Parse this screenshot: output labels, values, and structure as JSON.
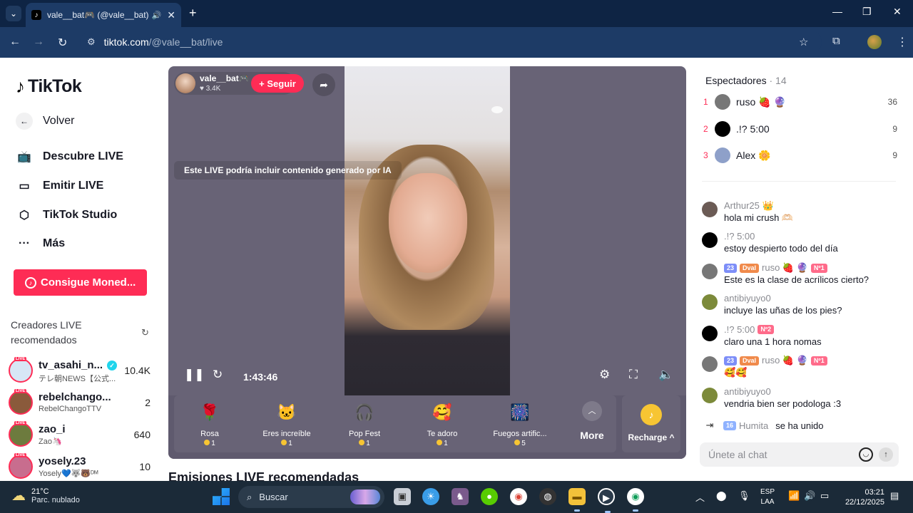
{
  "browser": {
    "tab_title": "vale__bat🎮 (@vale__bat) e",
    "url_host": "tiktok.com",
    "url_path": "/@vale__bat/live"
  },
  "sidebar": {
    "logo": "TikTok",
    "back_label": "Volver",
    "nav": [
      {
        "label": "Descubre LIVE",
        "icon": "tv-icon"
      },
      {
        "label": "Emitir LIVE",
        "icon": "camera-icon"
      },
      {
        "label": "TikTok Studio",
        "icon": "studio-icon"
      },
      {
        "label": "Más",
        "icon": "more-icon"
      }
    ],
    "coins_button": "Consigue Moned...",
    "recommended_title": "Creadores LIVE recomendados",
    "creators": [
      {
        "name": "tv_asahi_n...",
        "sub": "テレ朝NEWS【公式...",
        "count": "10.4K",
        "verified": true,
        "color": "#d7e6f5"
      },
      {
        "name": "rebelchango...",
        "sub": "RebelChangoTTV",
        "count": "2",
        "color": "#8a5a3b"
      },
      {
        "name": "zao_i",
        "sub": "Zao🦄",
        "count": "640",
        "color": "#6d7b3e"
      },
      {
        "name": "yosely.23",
        "sub": "Yosely💙🐺🐻ᴰᴹ",
        "count": "10",
        "color": "#c86d8e"
      }
    ],
    "live_tag": "LIVE"
  },
  "player": {
    "host_name": "vale__bat🎮",
    "host_likes": "♥ 3.4K",
    "follow": "+ Seguir",
    "ai_notice": "Este LIVE podría incluir contenido generado por IA",
    "elapsed": "1:43:46",
    "gifts": [
      {
        "name": "Rosa",
        "price": "1",
        "icon": "🌹"
      },
      {
        "name": "Eres increíble",
        "price": "1",
        "icon": "🐱"
      },
      {
        "name": "Pop Fest",
        "price": "1",
        "icon": "🎧"
      },
      {
        "name": "Te adoro",
        "price": "1",
        "icon": "🥰"
      },
      {
        "name": "Fuegos artific...",
        "price": "5",
        "icon": "🎆"
      }
    ],
    "more_label": "More",
    "recharge_label": "Recharge ^"
  },
  "below_section": "Emisiones LIVE recomendadas",
  "viewers": {
    "title": "Espectadores",
    "count": "· 14",
    "top": [
      {
        "rank": "1",
        "name": "ruso 🍓 🔮",
        "score": "36",
        "color": "#777"
      },
      {
        "rank": "2",
        "name": ".!? 5:00",
        "score": "9",
        "color": "#000"
      },
      {
        "rank": "3",
        "name": "Alex 🌼",
        "score": "9",
        "color": "#8ea0c9"
      }
    ]
  },
  "chat": [
    {
      "user": "Arthur25 👑",
      "text": "hola mi crush 🫶🏻",
      "badges": [],
      "color": "#6b5b55"
    },
    {
      "user": ".!? 5:00",
      "text": "estoy despierto todo del día",
      "badges": [],
      "color": "#000"
    },
    {
      "user": "ruso 🍓 🔮",
      "text": "Este es la clase de acrílicos cierto?",
      "badges": [
        "23",
        "Dval",
        "Nº1"
      ],
      "color": "#777"
    },
    {
      "user": "antibiyuyo0",
      "text": "incluye las uñas de los pies?",
      "badges": [],
      "color": "#7c8a3a"
    },
    {
      "user": ".!? 5:00",
      "text": "claro una 1 hora nomas",
      "badges": [
        "Nº2"
      ],
      "color": "#000"
    },
    {
      "user": "ruso 🍓 🔮",
      "text": "🥰🥰",
      "badges": [
        "23",
        "Dval",
        "Nº1"
      ],
      "color": "#777"
    },
    {
      "user": "antibiyuyo0",
      "text": "vendria bien ser podologa :3",
      "badges": [],
      "color": "#7c8a3a"
    }
  ],
  "joined": {
    "level": "16",
    "user": "Humita",
    "text": "se ha unido"
  },
  "chat_input_placeholder": "Únete al chat",
  "taskbar": {
    "temp": "21°C",
    "condition": "Parc. nublado",
    "search": "Buscar",
    "lang1": "ESP",
    "lang2": "LAA",
    "time": "03:21",
    "date": "22/12/2025"
  }
}
